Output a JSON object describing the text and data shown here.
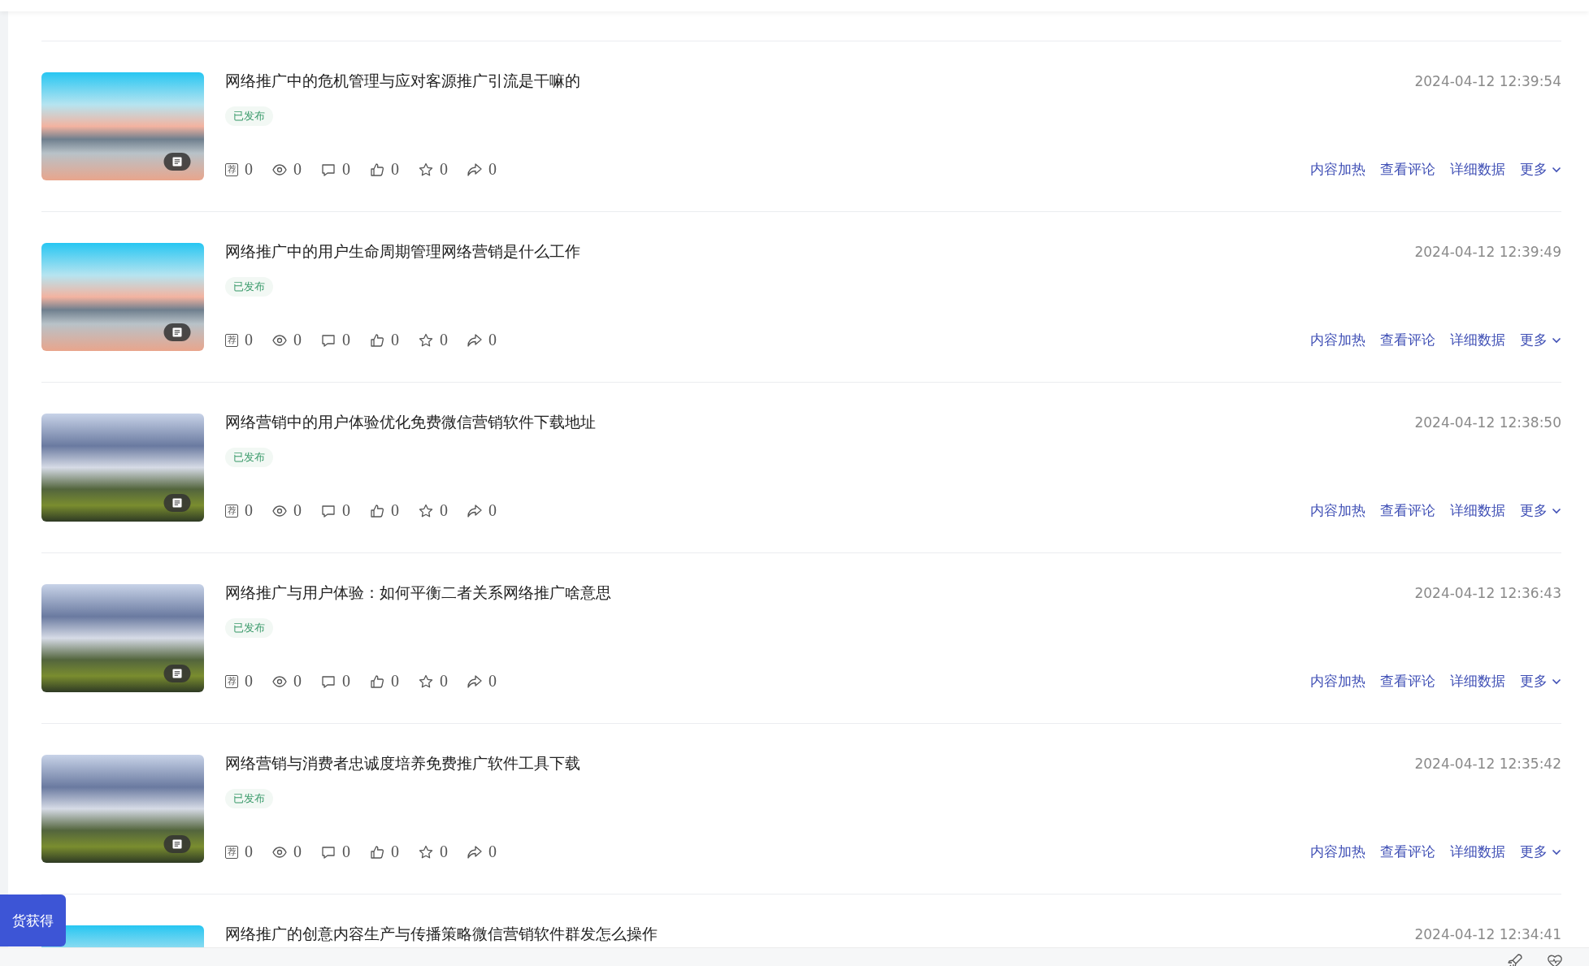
{
  "articles": [
    {
      "thumbnail": {
        "kind": "lake"
      },
      "title": "网络推广中的危机管理与应对客源推广引流是干嘛的",
      "status": "已发布",
      "time": "2024-04-12 12:39:54",
      "stats": [
        {
          "kind": "recommend",
          "icon_text": "荐",
          "value": "0"
        },
        {
          "kind": "views",
          "value": "0"
        },
        {
          "kind": "comments",
          "value": "0"
        },
        {
          "kind": "likes",
          "value": "0"
        },
        {
          "kind": "favorites",
          "value": "0"
        },
        {
          "kind": "shares",
          "value": "0"
        }
      ],
      "actions": [
        "内容加热",
        "查看评论",
        "详细数据"
      ],
      "more": "更多"
    },
    {
      "thumbnail": {
        "kind": "lake"
      },
      "title": "网络推广中的用户生命周期管理网络营销是什么工作",
      "status": "已发布",
      "time": "2024-04-12 12:39:49",
      "stats": [
        {
          "kind": "recommend",
          "icon_text": "荐",
          "value": "0"
        },
        {
          "kind": "views",
          "value": "0"
        },
        {
          "kind": "comments",
          "value": "0"
        },
        {
          "kind": "likes",
          "value": "0"
        },
        {
          "kind": "favorites",
          "value": "0"
        },
        {
          "kind": "shares",
          "value": "0"
        }
      ],
      "actions": [
        "内容加热",
        "查看评论",
        "详细数据"
      ],
      "more": "更多"
    },
    {
      "thumbnail": {
        "kind": "mountain"
      },
      "title": "网络营销中的用户体验优化免费微信营销软件下载地址",
      "status": "已发布",
      "time": "2024-04-12 12:38:50",
      "stats": [
        {
          "kind": "recommend",
          "icon_text": "荐",
          "value": "0"
        },
        {
          "kind": "views",
          "value": "0"
        },
        {
          "kind": "comments",
          "value": "0"
        },
        {
          "kind": "likes",
          "value": "0"
        },
        {
          "kind": "favorites",
          "value": "0"
        },
        {
          "kind": "shares",
          "value": "0"
        }
      ],
      "actions": [
        "内容加热",
        "查看评论",
        "详细数据"
      ],
      "more": "更多"
    },
    {
      "thumbnail": {
        "kind": "mountain"
      },
      "title": "网络推广与用户体验：如何平衡二者关系网络推广啥意思",
      "status": "已发布",
      "time": "2024-04-12 12:36:43",
      "stats": [
        {
          "kind": "recommend",
          "icon_text": "荐",
          "value": "0"
        },
        {
          "kind": "views",
          "value": "0"
        },
        {
          "kind": "comments",
          "value": "0"
        },
        {
          "kind": "likes",
          "value": "0"
        },
        {
          "kind": "favorites",
          "value": "0"
        },
        {
          "kind": "shares",
          "value": "0"
        }
      ],
      "actions": [
        "内容加热",
        "查看评论",
        "详细数据"
      ],
      "more": "更多"
    },
    {
      "thumbnail": {
        "kind": "mountain"
      },
      "title": "网络营销与消费者忠诚度培养免费推广软件工具下载",
      "status": "已发布",
      "time": "2024-04-12 12:35:42",
      "stats": [
        {
          "kind": "recommend",
          "icon_text": "荐",
          "value": "0"
        },
        {
          "kind": "views",
          "value": "0"
        },
        {
          "kind": "comments",
          "value": "0"
        },
        {
          "kind": "likes",
          "value": "0"
        },
        {
          "kind": "favorites",
          "value": "0"
        },
        {
          "kind": "shares",
          "value": "0"
        }
      ],
      "actions": [
        "内容加热",
        "查看评论",
        "详细数据"
      ],
      "more": "更多"
    },
    {
      "thumbnail": {
        "kind": "lake"
      },
      "title": "网络推广的创意内容生产与传播策略微信营销软件群发怎么操作",
      "time": "2024-04-12 12:34:41"
    }
  ],
  "floating_button": "货获得"
}
